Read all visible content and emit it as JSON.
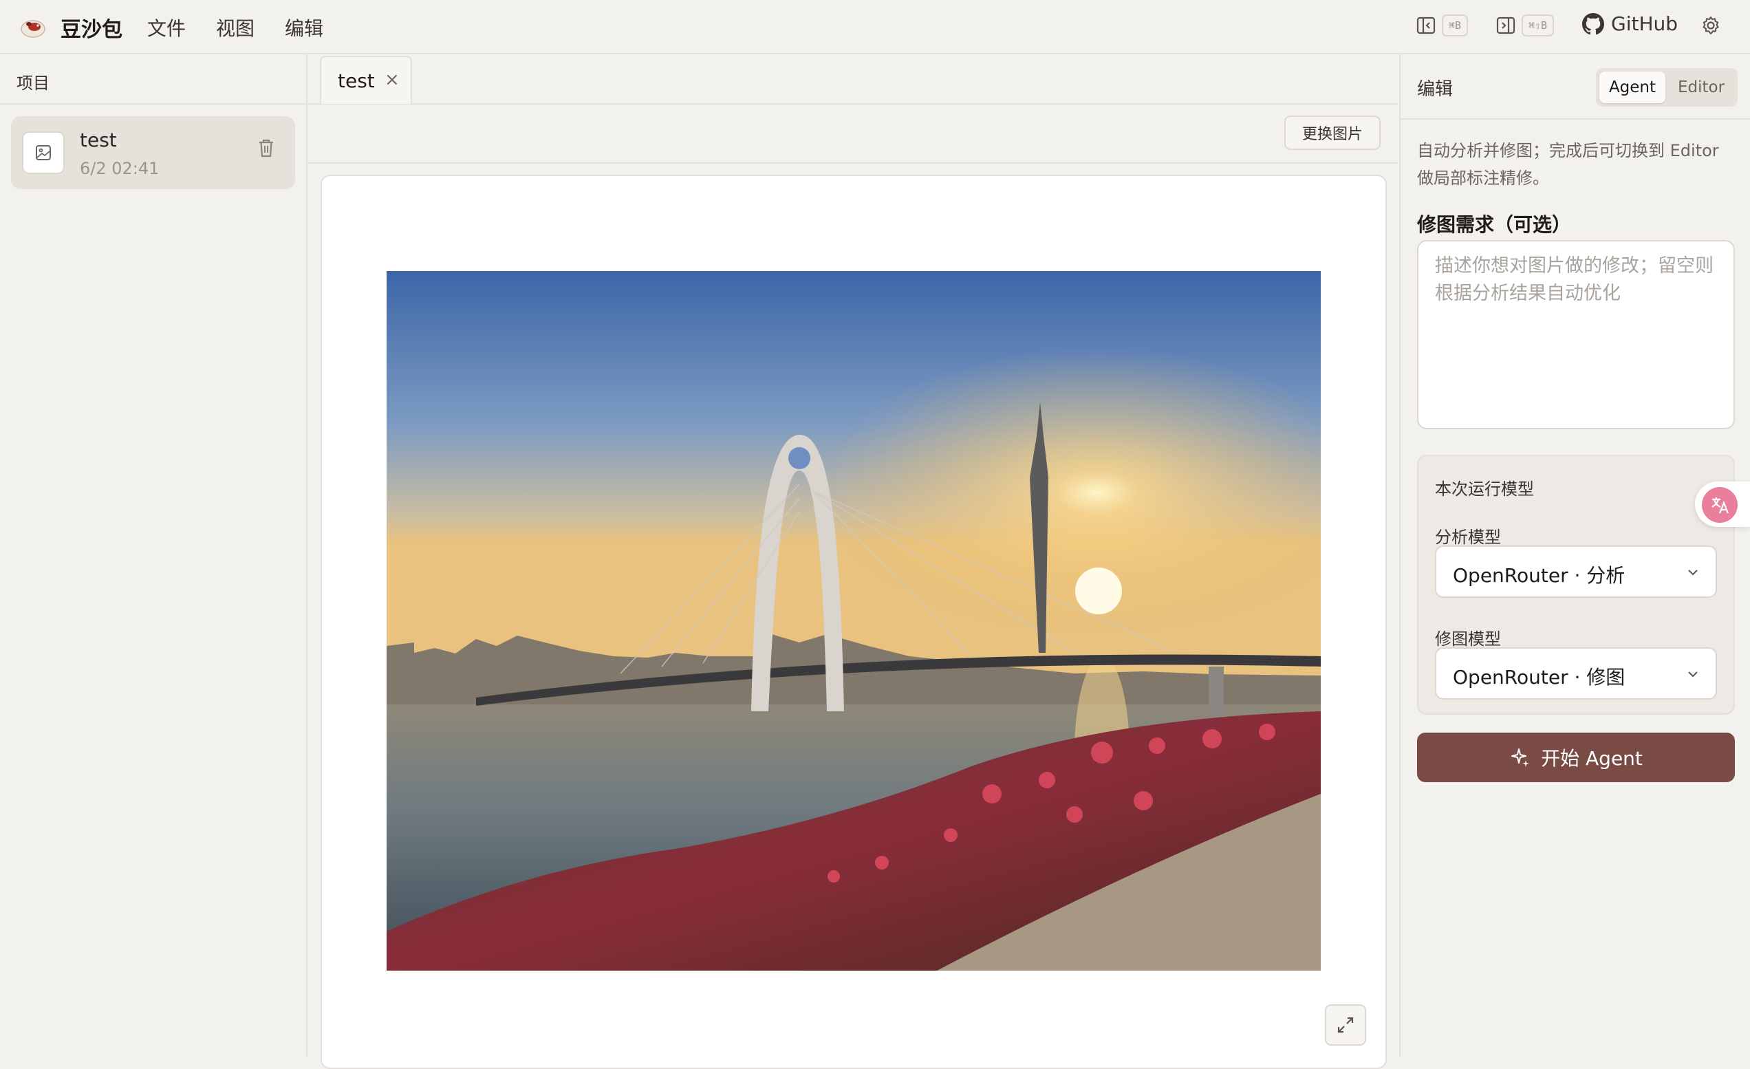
{
  "app": {
    "name": "豆沙包"
  },
  "menu": {
    "file": "文件",
    "view": "视图",
    "edit": "编辑"
  },
  "toolbar": {
    "left_panel_shortcut": "⌘B",
    "right_panel_shortcut": "⌘⇧B",
    "github_label": "GitHub"
  },
  "sidebar": {
    "header": "项目",
    "projects": [
      {
        "name": "test",
        "date": "6/2 02:41"
      }
    ]
  },
  "tabs": [
    {
      "label": "test",
      "close": "×"
    }
  ],
  "canvas_toolbar": {
    "replace_image": "更换图片"
  },
  "right_panel": {
    "title": "编辑",
    "modes": {
      "agent": "Agent",
      "editor": "Editor",
      "active": "agent"
    },
    "description": "自动分析并修图；完成后可切换到 Editor 做局部标注精修。",
    "request_label": "修图需求（可选）",
    "request_placeholder": "描述你想对图片做的修改；留空则根据分析结果自动优化",
    "request_value": "",
    "model_section": {
      "title": "本次运行模型",
      "analysis_label": "分析模型",
      "analysis_value": "OpenRouter · 分析",
      "edit_label": "修图模型",
      "edit_value": "OpenRouter · 修图"
    },
    "start_button": "开始 Agent"
  },
  "colors": {
    "accent": "#7a4a45",
    "background": "#f3f1ee",
    "border": "#e3dfda",
    "translate_badge": "#ea7f9c"
  },
  "icons": {
    "logo": "bean-bun-logo",
    "left_panel": "sidebar-left-icon",
    "right_panel": "sidebar-right-icon",
    "github": "github-icon",
    "settings": "gear-icon",
    "project": "image-icon",
    "delete": "trash-icon",
    "expand": "expand-icon",
    "chevron": "chevron-down-icon",
    "sparkle": "sparkle-icon",
    "translate": "translate-icon"
  }
}
